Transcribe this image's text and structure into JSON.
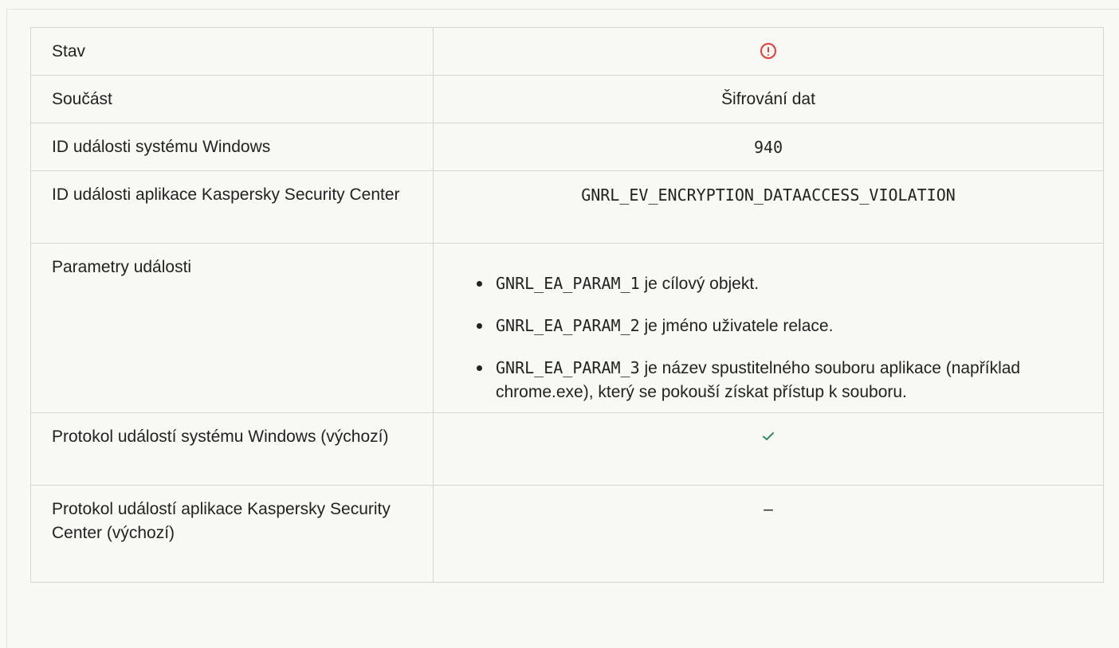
{
  "rows": {
    "stav": {
      "label": "Stav",
      "status_icon": "error-circle-icon",
      "status_color": "#e23c3c"
    },
    "soucast": {
      "label": "Součást",
      "value": "Šifrování dat"
    },
    "win_id": {
      "label": "ID události systému Windows",
      "value": "940"
    },
    "ksc_id": {
      "label": "ID události aplikace Kaspersky Security Center",
      "value": "GNRL_EV_ENCRYPTION_DATAACCESS_VIOLATION"
    },
    "params": {
      "label": "Parametry události",
      "items": [
        {
          "code": "GNRL_EA_PARAM_1",
          "text": " je cílový objekt."
        },
        {
          "code": "GNRL_EA_PARAM_2",
          "text": " je jméno uživatele relace."
        },
        {
          "code": "GNRL_EA_PARAM_3",
          "text": " je název spustitelného souboru aplikace (například chrome.exe), který se pokouší získat přístup k souboru."
        }
      ]
    },
    "win_log": {
      "label": "Protokol událostí systému Windows (výchozí)",
      "icon": "checkmark-icon",
      "icon_color": "#2e8b6e"
    },
    "ksc_log": {
      "label": "Protokol událostí aplikace Kaspersky Security Center (výchozí)",
      "value": "–"
    }
  }
}
